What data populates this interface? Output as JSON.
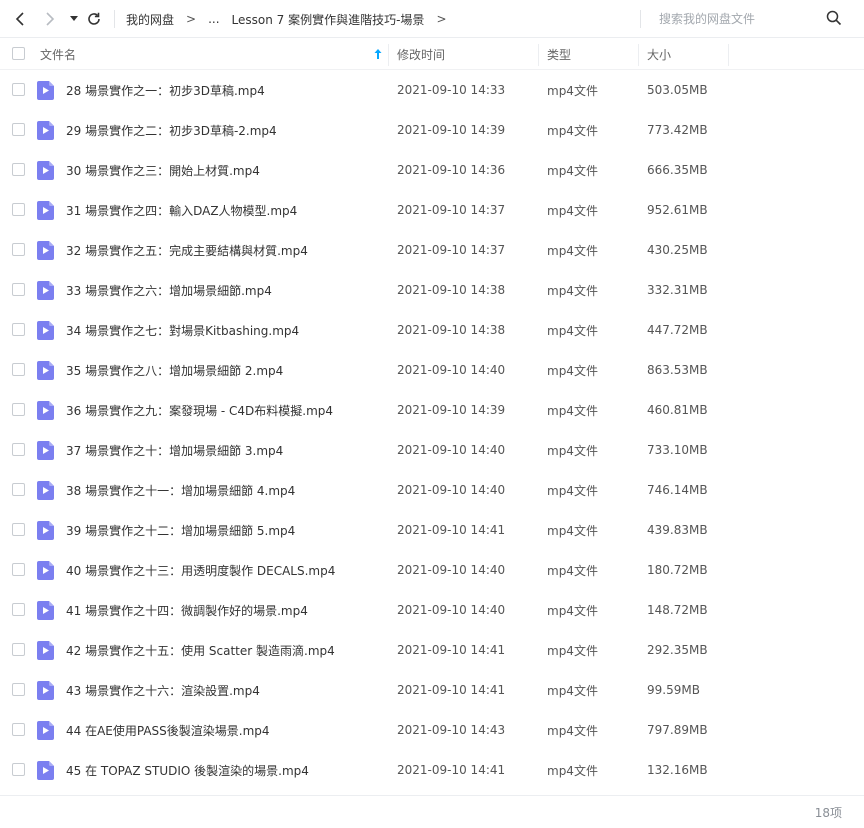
{
  "toolbar": {
    "breadcrumb": [
      "我的网盘",
      "...",
      "Lesson 7 案例實作與進階技巧-場景"
    ],
    "separator": ">",
    "search_placeholder": "搜索我的网盘文件"
  },
  "columns": {
    "name": "文件名",
    "modified": "修改时间",
    "type": "类型",
    "size": "大小"
  },
  "files": [
    {
      "name": "28 場景實作之一：初步3D草稿.mp4",
      "modified": "2021-09-10 14:33",
      "type": "mp4文件",
      "size": "503.05MB"
    },
    {
      "name": "29 場景實作之二：初步3D草稿-2.mp4",
      "modified": "2021-09-10 14:39",
      "type": "mp4文件",
      "size": "773.42MB"
    },
    {
      "name": "30 場景實作之三：開始上材質.mp4",
      "modified": "2021-09-10 14:36",
      "type": "mp4文件",
      "size": "666.35MB"
    },
    {
      "name": "31 場景實作之四：輸入DAZ人物模型.mp4",
      "modified": "2021-09-10 14:37",
      "type": "mp4文件",
      "size": "952.61MB"
    },
    {
      "name": "32 場景實作之五：完成主要結構與材質.mp4",
      "modified": "2021-09-10 14:37",
      "type": "mp4文件",
      "size": "430.25MB"
    },
    {
      "name": "33 場景實作之六：增加場景細節.mp4",
      "modified": "2021-09-10 14:38",
      "type": "mp4文件",
      "size": "332.31MB"
    },
    {
      "name": "34 場景實作之七：對場景Kitbashing.mp4",
      "modified": "2021-09-10 14:38",
      "type": "mp4文件",
      "size": "447.72MB"
    },
    {
      "name": "35 場景實作之八：增加場景細節 2.mp4",
      "modified": "2021-09-10 14:40",
      "type": "mp4文件",
      "size": "863.53MB"
    },
    {
      "name": "36 場景實作之九：案發現場 - C4D布料模擬.mp4",
      "modified": "2021-09-10 14:39",
      "type": "mp4文件",
      "size": "460.81MB"
    },
    {
      "name": "37 場景實作之十：增加場景細節 3.mp4",
      "modified": "2021-09-10 14:40",
      "type": "mp4文件",
      "size": "733.10MB"
    },
    {
      "name": "38 場景實作之十一：增加場景細節 4.mp4",
      "modified": "2021-09-10 14:40",
      "type": "mp4文件",
      "size": "746.14MB"
    },
    {
      "name": "39 場景實作之十二：增加場景細節 5.mp4",
      "modified": "2021-09-10 14:41",
      "type": "mp4文件",
      "size": "439.83MB"
    },
    {
      "name": "40 場景實作之十三：用透明度製作 DECALS.mp4",
      "modified": "2021-09-10 14:40",
      "type": "mp4文件",
      "size": "180.72MB"
    },
    {
      "name": "41 場景實作之十四：微調製作好的場景.mp4",
      "modified": "2021-09-10 14:40",
      "type": "mp4文件",
      "size": "148.72MB"
    },
    {
      "name": "42 場景實作之十五：使用 Scatter 製造雨滴.mp4",
      "modified": "2021-09-10 14:41",
      "type": "mp4文件",
      "size": "292.35MB"
    },
    {
      "name": "43 場景實作之十六：渲染設置.mp4",
      "modified": "2021-09-10 14:41",
      "type": "mp4文件",
      "size": "99.59MB"
    },
    {
      "name": "44 在AE使用PASS後製渲染場景.mp4",
      "modified": "2021-09-10 14:43",
      "type": "mp4文件",
      "size": "797.89MB"
    },
    {
      "name": "45 在 TOPAZ STUDIO 後製渲染的場景.mp4",
      "modified": "2021-09-10 14:41",
      "type": "mp4文件",
      "size": "132.16MB"
    }
  ],
  "footer": {
    "count": "18项"
  },
  "colors": {
    "icon": "#7b7ff0",
    "accent": "#06a7ff"
  }
}
